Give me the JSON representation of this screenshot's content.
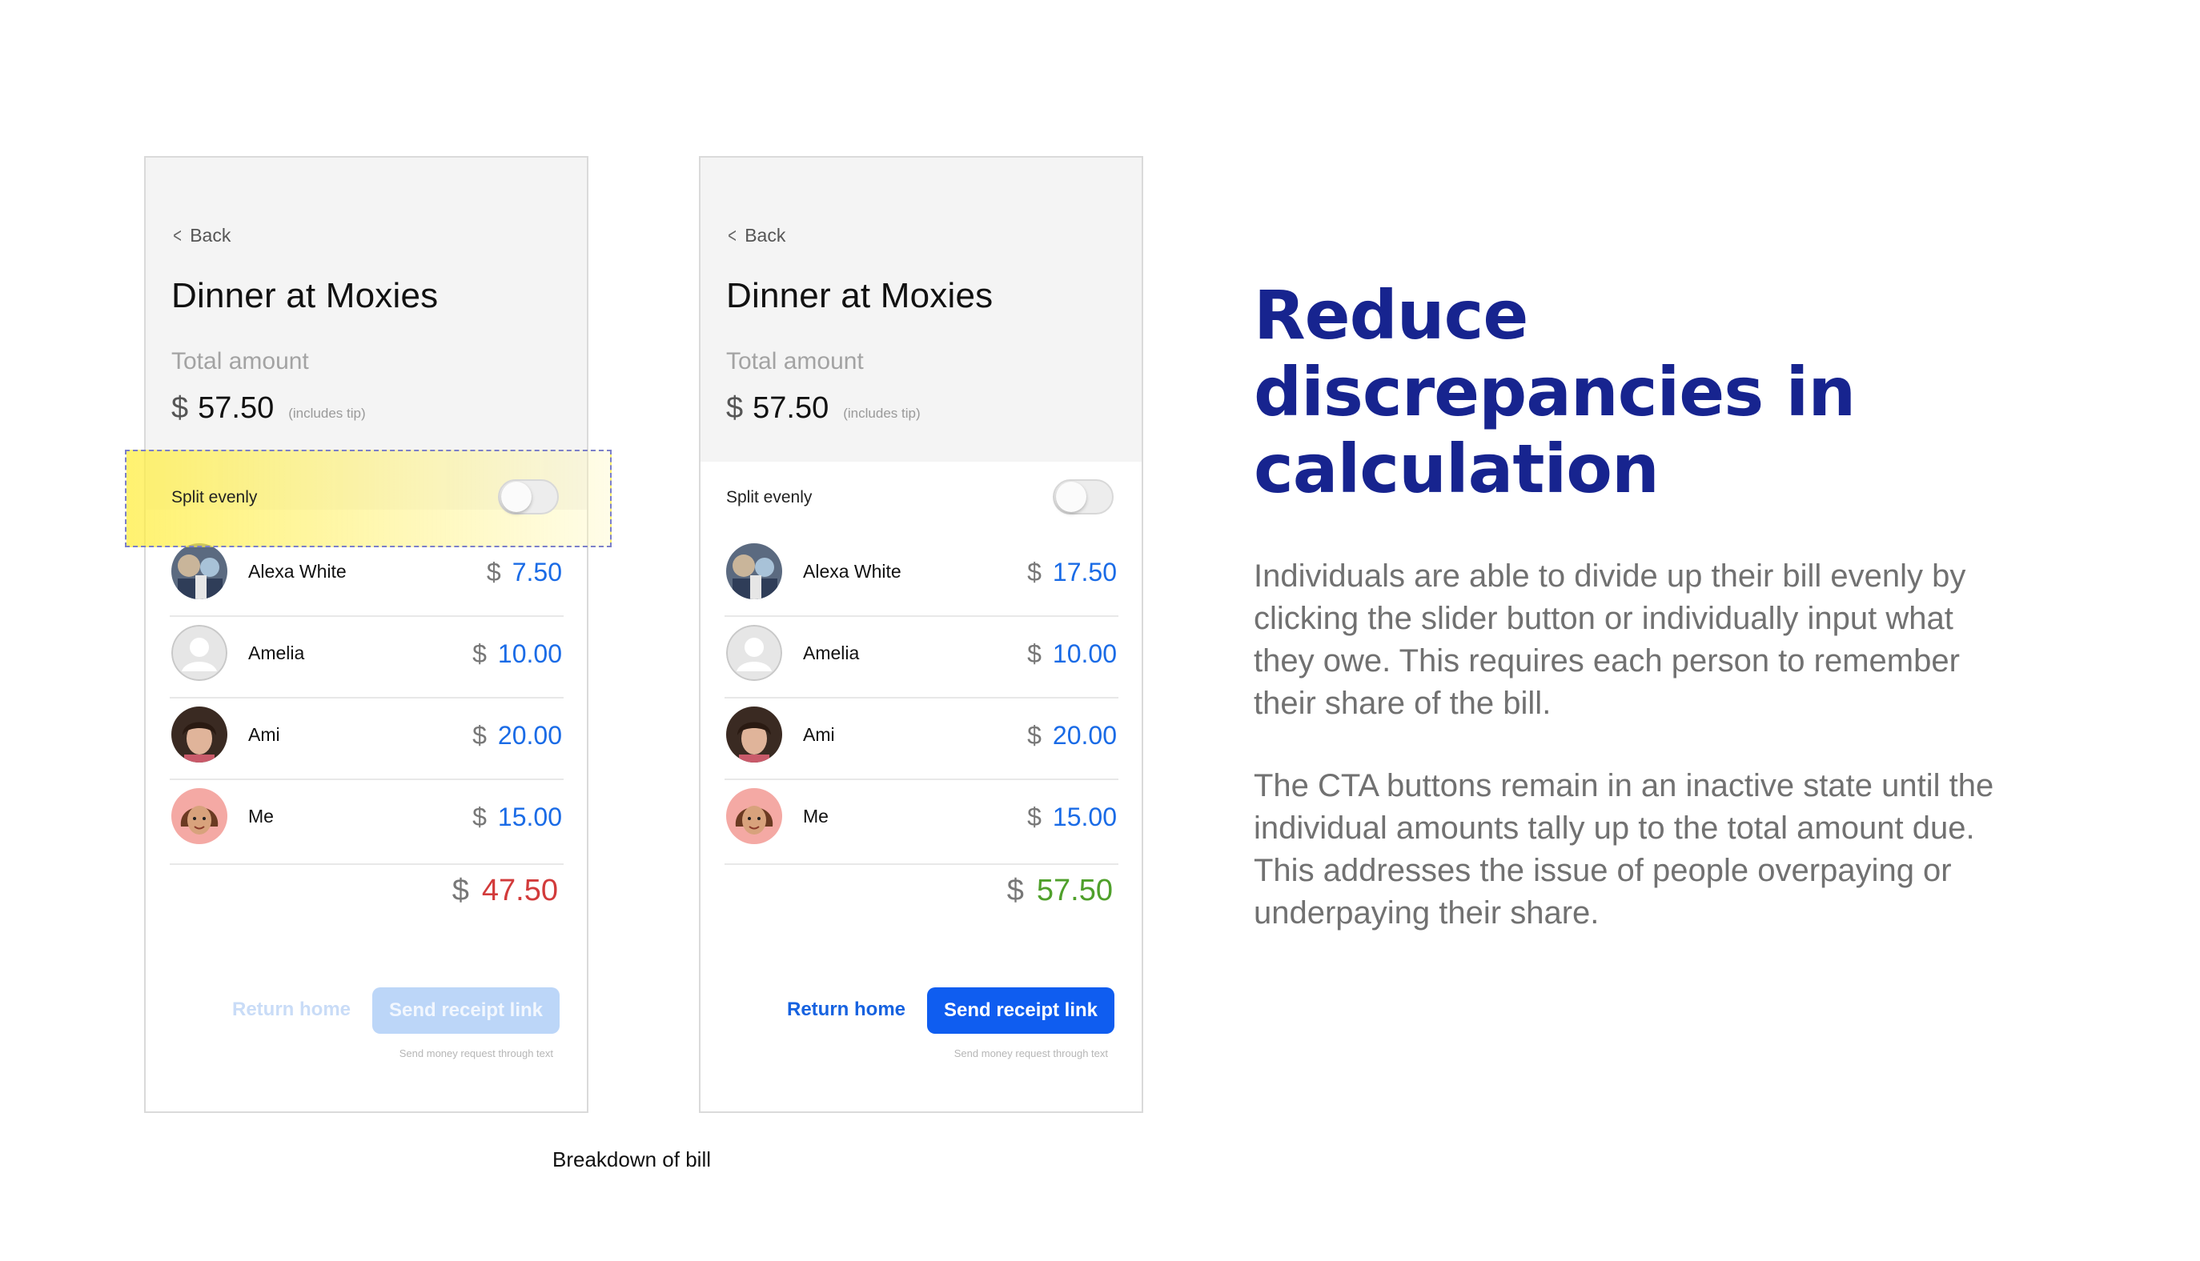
{
  "screens": [
    {
      "back_label": "Back",
      "title": "Dinner at Moxies",
      "total_label": "Total amount",
      "currency": "$",
      "total_amount": "57.50",
      "total_note": "(includes tip)",
      "split_label": "Split evenly",
      "split_on": false,
      "people": [
        {
          "name": "Alexa White",
          "amount": "7.50"
        },
        {
          "name": "Amelia",
          "amount": "10.00"
        },
        {
          "name": "Ami",
          "amount": "20.00"
        },
        {
          "name": "Me",
          "amount": "15.00"
        }
      ],
      "sum_amount": "47.50",
      "sum_color": "#d23b3b",
      "return_label": "Return home",
      "send_label": "Send receipt link",
      "send_note": "Send money request through text",
      "buttons_active": false
    },
    {
      "back_label": "Back",
      "title": "Dinner at Moxies",
      "total_label": "Total amount",
      "currency": "$",
      "total_amount": "57.50",
      "total_note": "(includes tip)",
      "split_label": "Split evenly",
      "split_on": false,
      "people": [
        {
          "name": "Alexa White",
          "amount": "17.50"
        },
        {
          "name": "Amelia",
          "amount": "10.00"
        },
        {
          "name": "Ami",
          "amount": "20.00"
        },
        {
          "name": "Me",
          "amount": "15.00"
        }
      ],
      "sum_amount": "57.50",
      "sum_color": "#4fa02b",
      "return_label": "Return home",
      "send_label": "Send receipt link",
      "send_note": "Send money request through text",
      "buttons_active": true
    }
  ],
  "caption": "Breakdown of bill",
  "headline": "Reduce discrepancies in calculation",
  "paragraph_1": "Individuals are able to divide up their bill evenly by clicking the slider button or individually input what they owe. This requires each person to remember their share of the bill.",
  "paragraph_2": "The CTA buttons remain in an inactive state until the individual amounts tally up to the total amount due. This addresses the issue of people overpaying or underpaying their share.",
  "colors": {
    "headline": "#17248f",
    "accent_blue": "#0f5df0",
    "amount_blue": "#1a6be6",
    "highlight_yellow": "#ffee40"
  }
}
